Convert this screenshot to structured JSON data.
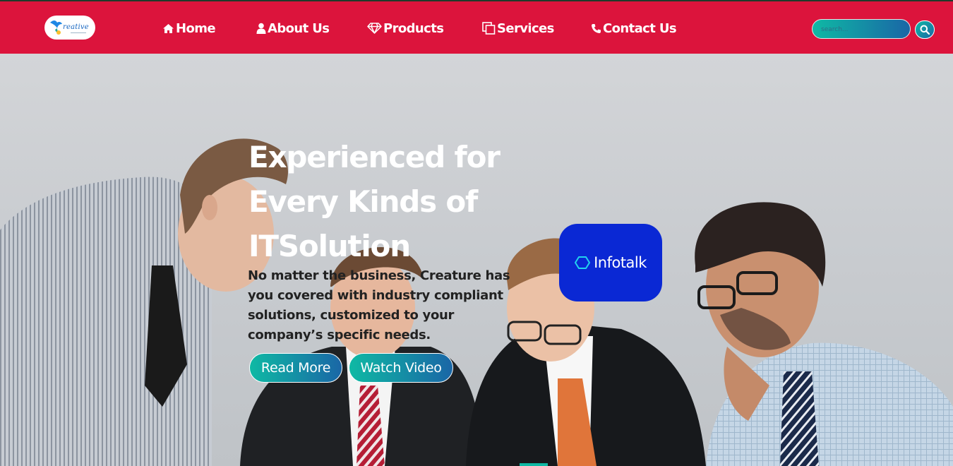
{
  "brand": {
    "logo_text": "reative",
    "logo_name": "Creative logo"
  },
  "nav": {
    "items": [
      {
        "label": "Home",
        "icon": "home-icon"
      },
      {
        "label": "About Us",
        "icon": "user-icon"
      },
      {
        "label": "Products",
        "icon": "diamond-icon"
      },
      {
        "label": "Services",
        "icon": "copy-icon"
      },
      {
        "label": "Contact Us",
        "icon": "phone-icon"
      }
    ]
  },
  "search": {
    "placeholder": "search...",
    "value": "",
    "button_icon": "search-icon"
  },
  "hero": {
    "title": "Experienced for Every Kinds of ITSolution",
    "description": "No matter the business, Creature has you covered with industry compliant solutions, customized to your company’s specific needs.",
    "read_more": "Read More",
    "watch_video": "Watch Video"
  },
  "badge": {
    "label": "Infotalk",
    "icon": "chat-bubble-icon"
  },
  "colors": {
    "nav_bg": "#dc143c",
    "accent_start": "#0fb9a4",
    "accent_end": "#1a66a6",
    "badge_bg": "#0a28d4"
  }
}
